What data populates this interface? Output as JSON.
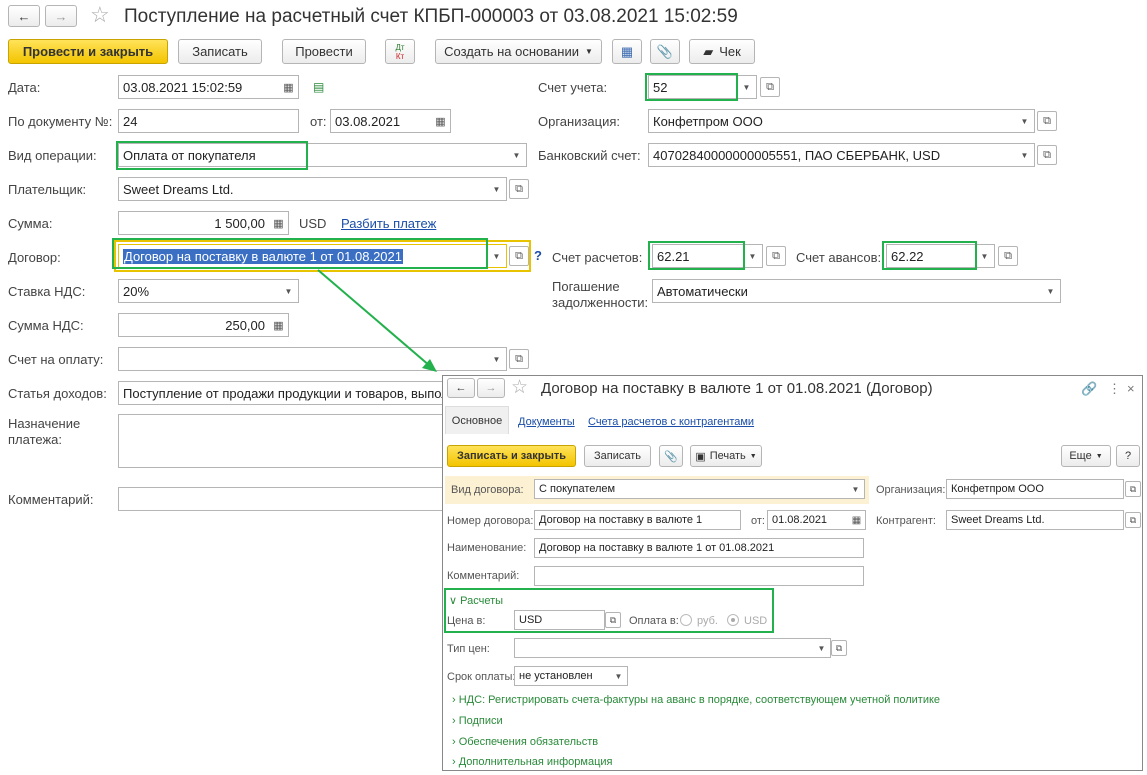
{
  "window": {
    "title": "Поступление на расчетный счет КПБП-000003 от 03.08.2021 15:02:59",
    "back": "←",
    "fwd": "→",
    "star": "☆"
  },
  "toolbar": {
    "post_close": "Провести и закрыть",
    "save": "Записать",
    "post": "Провести",
    "dtkt_top": "Дт",
    "dtkt_bottom": "Кт",
    "create_based": "Создать на основании",
    "check": "Чек"
  },
  "form": {
    "date_label": "Дата:",
    "date_value": "03.08.2021 15:02:59",
    "docnum_label": "По документу №:",
    "docnum_value": "24",
    "from_label": "от:",
    "from_value": "03.08.2021",
    "optype_label": "Вид операции:",
    "optype_value": "Оплата от покупателя",
    "payer_label": "Плательщик:",
    "payer_value": "Sweet Dreams Ltd.",
    "sum_label": "Сумма:",
    "sum_value": "1 500,00",
    "currency": "USD",
    "split_link": "Разбить платеж",
    "contract_label": "Договор:",
    "contract_value": "Договор на поставку в валюте 1 от 01.08.2021",
    "help": "?",
    "vat_rate_label": "Ставка НДС:",
    "vat_rate_value": "20%",
    "vat_sum_label": "Сумма НДС:",
    "vat_sum_value": "250,00",
    "invoice_label": "Счет на оплату:",
    "invoice_value": "",
    "income_label": "Статья доходов:",
    "income_value": "Поступление от продажи продукции и товаров, выпол",
    "purpose_label_1": "Назначение",
    "purpose_label_2": "платежа:",
    "comment_label": "Комментарий:",
    "account_label": "Счет учета:",
    "account_value": "52",
    "org_label": "Организация:",
    "org_value": "Конфетпром ООО",
    "bank_label": "Банковский счет:",
    "bank_value": "40702840000000005551, ПАО СБЕРБАНК, USD",
    "settle_label": "Счет расчетов:",
    "settle_value": "62.21",
    "advance_label": "Счет авансов:",
    "advance_value": "62.22",
    "repay_label_1": "Погашение",
    "repay_label_2": "задолженности:",
    "repay_value": "Автоматически"
  },
  "contract_window": {
    "title": "Договор на поставку в валюте 1 от 01.08.2021 (Договор)",
    "tabs": [
      "Основное",
      "Документы",
      "Счета расчетов с контрагентами"
    ],
    "save_close": "Записать и закрыть",
    "save": "Записать",
    "print": "Печать",
    "more": "Еще",
    "help": "?",
    "kind_label": "Вид договора:",
    "kind_value": "С покупателем",
    "org_label": "Организация:",
    "org_value": "Конфетпром ООО",
    "number_label": "Номер договора:",
    "number_value": "Договор на поставку в валюте 1",
    "date_label": "от:",
    "date_value": "01.08.2021",
    "counterparty_label": "Контрагент:",
    "counterparty_value": "Sweet Dreams Ltd.",
    "name_label": "Наименование:",
    "name_value": "Договор на поставку в валюте 1 от 01.08.2021",
    "comment_label": "Комментарий:",
    "settlements_header": "Расчеты",
    "price_label": "Цена в:",
    "price_value": "USD",
    "payment_label": "Оплата в:",
    "pay_rub": "руб.",
    "pay_usd": "USD",
    "price_type_label": "Тип цен:",
    "term_label": "Срок оплаты:",
    "term_value": "не установлен",
    "sections": [
      "НДС: Регистрировать счета-фактуры на аванс в порядке, соответствующем учетной политике",
      "Подписи",
      "Обеспечения обязательств",
      "Дополнительная информация"
    ]
  }
}
